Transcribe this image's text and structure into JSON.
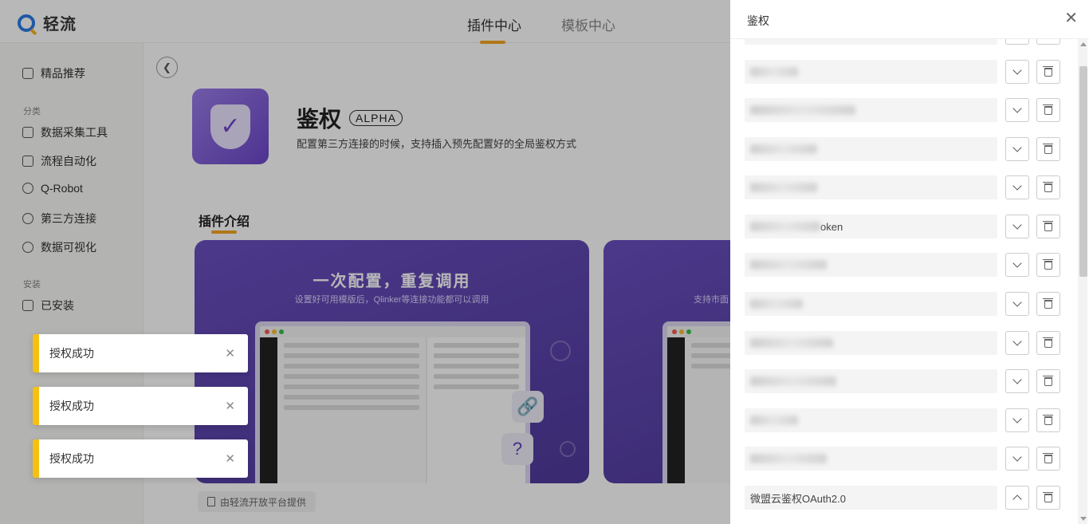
{
  "header": {
    "logo_text": "轻流",
    "tabs": [
      {
        "label": "插件中心",
        "active": true
      },
      {
        "label": "模板中心",
        "active": false
      }
    ]
  },
  "sidebar": {
    "featured": "精品推荐",
    "category_label": "分类",
    "categories": [
      "数据采集工具",
      "流程自动化",
      "Q-Robot",
      "第三方连接",
      "数据可视化"
    ],
    "installed_label": "安装",
    "installed": "已安装"
  },
  "plugin": {
    "name": "鉴权",
    "badge": "ALPHA",
    "description": "配置第三方连接的时候，支持插入预先配置好的全局鉴权方式",
    "section_title": "插件介绍",
    "banner1_title": "一次配置，重复调用",
    "banner1_sub": "设置好可用模版后，Qlinker等连接功能都可以调用",
    "banner2_sub": "支持市面",
    "provider": "由轻流开放平台提供"
  },
  "toasts": [
    {
      "text": "授权成功"
    },
    {
      "text": "授权成功"
    },
    {
      "text": "授权成功"
    }
  ],
  "drawer": {
    "title": "鉴权",
    "rows": [
      {
        "text": "",
        "expanded": false
      },
      {
        "text": "",
        "expanded": false
      },
      {
        "text": "",
        "expanded": false
      },
      {
        "text": "",
        "expanded": false
      },
      {
        "text": "oken",
        "expanded": false
      },
      {
        "text": "",
        "expanded": false
      },
      {
        "text": "",
        "expanded": false
      },
      {
        "text": "",
        "expanded": false
      },
      {
        "text": "",
        "expanded": false
      },
      {
        "text": "",
        "expanded": false
      },
      {
        "text": "",
        "expanded": false
      },
      {
        "text": "",
        "expanded": false
      },
      {
        "text": "微盟云鉴权OAuth2.0",
        "expanded": true
      }
    ]
  },
  "colors": {
    "accent": "#f5a623",
    "toast_bar": "#f5c012",
    "banner": "#5b43b0"
  }
}
